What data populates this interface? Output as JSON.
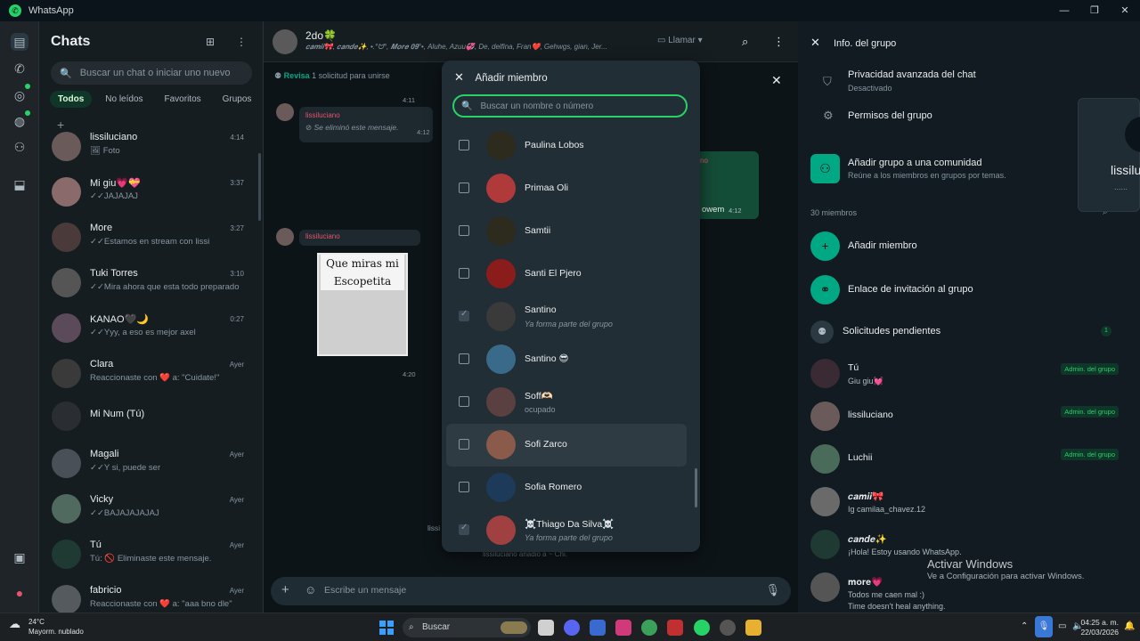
{
  "window": {
    "title": "WhatsApp",
    "controls": [
      "—",
      "❐",
      "✕"
    ]
  },
  "chat_list": {
    "title": "Chats",
    "search_placeholder": "Buscar un chat o iniciar uno nuevo",
    "filters": [
      "Todos",
      "No leídos",
      "Favoritos",
      "Grupos"
    ],
    "items": [
      {
        "name": "lissiluciano",
        "msg": "🖼 Foto",
        "time": "4:14",
        "color": "#6b5a5a"
      },
      {
        "name": "Mi giu💗💝",
        "msg": "✓✓JAJAJAJ",
        "time": "3:37",
        "color": "#8a6a6a"
      },
      {
        "name": "More",
        "msg": "✓✓Estamos en stream con lissi",
        "time": "3:27",
        "color": "#4a3a3a"
      },
      {
        "name": "Tuki Torres",
        "msg": "✓✓Mira ahora que esta todo preparado",
        "time": "3:10",
        "color": "#555555"
      },
      {
        "name": "KANAO🖤🌙",
        "msg": "✓✓Yyy, a eso es mejor axel",
        "time": "0:27",
        "color": "#5a4a5a"
      },
      {
        "name": "Clara",
        "msg": "Reaccionaste con ❤️ a: \"Cuidate!\"",
        "time": "Ayer",
        "color": "#3a3a3a"
      },
      {
        "name": "Mi Num (Tú)",
        "msg": "",
        "time": "",
        "color": "#2a2e33"
      },
      {
        "name": "Magali",
        "msg": "✓✓Y si, puede ser",
        "time": "Ayer",
        "color": "#4a5058"
      },
      {
        "name": "Vicky",
        "msg": "✓✓BAJAJAJAJAJ",
        "time": "Ayer",
        "color": "#506a60"
      },
      {
        "name": "Tú",
        "msg": "Tú: 🚫 Eliminaste este mensaje.",
        "time": "Ayer",
        "color": "#1e3a33"
      },
      {
        "name": "fabricio",
        "msg": "Reaccionaste con ❤️ a: \"aaa bno dle\"",
        "time": "Ayer",
        "color": "#555a5f"
      }
    ]
  },
  "chat": {
    "name": "2do🍀",
    "members_line": "𝒄𝒂𝒎𝒊𝒊🎀, 𝒄𝒂𝒏𝒅𝒆✨, •.°ᗢ°, 𝑴𝒐𝒓𝒆 𝟎𝟗°•, Aluhe, Azuu💞, De, delfina, Fran❤️, Gehwgs, gian, Jer...",
    "call_label": "Llamar",
    "request_label": "Revisa",
    "request_text": "1 solicitud para unirse",
    "msg1_sender": "lissiluciano",
    "msg1_text": "Se eliminó este mensaje.",
    "msg1_time": "4:12",
    "time_top": "4:11",
    "msg2_sender": "lissiluciano",
    "sticker_text": "Que miras mi Escopetita",
    "msg2_time": "4:20",
    "green_snippet": "owem",
    "green_time": "4:12",
    "green_name": "no",
    "bottom_note": "lissiluciano añadió a ~ Chi.",
    "bottom_left": "lissi",
    "composer_placeholder": "Escribe un mensaje"
  },
  "add_member_modal": {
    "title": "Añadir miembro",
    "search_placeholder": "Buscar un nombre o número",
    "items": [
      {
        "name": "Paulina Lobos",
        "sub": "",
        "state": "unchecked",
        "color": "#2d2a1e"
      },
      {
        "name": "Primaa Oli",
        "sub": "",
        "state": "unchecked",
        "color": "#b03a3a"
      },
      {
        "name": "Samtii",
        "sub": "",
        "state": "unchecked",
        "color": "#2d2a1e"
      },
      {
        "name": "Santi El Pjero",
        "sub": "",
        "state": "unchecked",
        "color": "#8a1c1c"
      },
      {
        "name": "Santino",
        "sub": "Ya forma parte del grupo",
        "state": "member",
        "color": "#3a3a3a"
      },
      {
        "name": "Santino 😎",
        "sub": "",
        "state": "unchecked",
        "color": "#3a6a8a"
      },
      {
        "name": "Soff🫶🏻",
        "sub": "ocupado",
        "state": "unchecked",
        "color": "#5a4040"
      },
      {
        "name": "Sofi Zarco",
        "sub": "",
        "state": "unchecked",
        "color": "#8a5a4a"
      },
      {
        "name": "Sofia Romero",
        "sub": "",
        "state": "unchecked",
        "color": "#1e3a5a"
      },
      {
        "name": "☠️Thiago Da Silva☠️",
        "sub": "Ya forma parte del grupo",
        "state": "member",
        "color": "#a04040"
      }
    ]
  },
  "group_info": {
    "title": "Info. del grupo",
    "privacy_title": "Privacidad avanzada del chat",
    "privacy_sub": "Desactivado",
    "perms_title": "Permisos del grupo",
    "community_title": "Añadir grupo a una comunidad",
    "community_sub": "Reúne a los miembros en grupos por temas.",
    "members_count": "30 miembros",
    "add_member": "Añadir miembro",
    "invite_link": "Enlace de invitación al grupo",
    "pending": "Solicitudes pendientes",
    "pending_count": "1",
    "popup_name": "lissilu",
    "popup_dots": "......",
    "admin_badge": "Admin. del grupo",
    "members": [
      {
        "name": "Tú",
        "status": "Giu giu💓",
        "admin": true,
        "color": "#3a2a33"
      },
      {
        "name": "lissiluciano",
        "status": "",
        "admin": true,
        "color": "#6b5a5a"
      },
      {
        "name": "Luchii",
        "status": "",
        "admin": true,
        "color": "#4a6a5a"
      },
      {
        "name": "𝒄𝒂𝒎𝒊𝒊🎀",
        "status": "Ig camilaa_chavez.12",
        "admin": false,
        "color": "#6a6a6a"
      },
      {
        "name": "𝒄𝒂𝒏𝒅𝒆✨",
        "status": "¡Hola! Estoy usando WhatsApp.",
        "admin": false,
        "color": "#1e3a33"
      },
      {
        "name": "𝐦𝐨𝐫𝐞💗",
        "status": "Todos me caen mal :)",
        "status2": "Time doesn't heal anything.",
        "admin": false,
        "color": "#555555"
      }
    ],
    "activate_title": "Activar Windows",
    "activate_sub": "Ve a Configuración para activar Windows."
  },
  "taskbar": {
    "temp": "24°C",
    "weather": "Mayorm. nublado",
    "search": "Buscar",
    "time": "04:25 a. m.",
    "date": "22/03/2026"
  }
}
